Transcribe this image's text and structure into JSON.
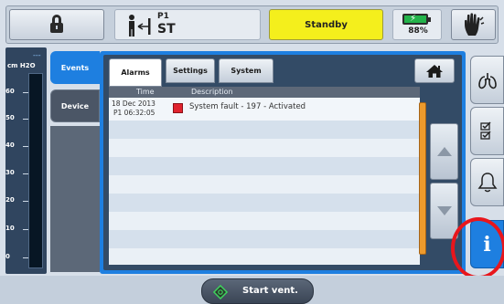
{
  "topbar": {
    "patient_id": "P1",
    "patient_mode": "ST",
    "status": "Standby",
    "battery_percent": "88%",
    "icons": [
      "lock-icon",
      "patient-icon",
      "battery-icon",
      "hand-icon"
    ]
  },
  "gauge": {
    "marker": "---",
    "unit": "cm H2O",
    "ticks": [
      "60",
      "50",
      "40",
      "30",
      "20",
      "10",
      "0"
    ]
  },
  "sidebar": {
    "items": [
      {
        "label": "Events",
        "selected": true
      },
      {
        "label": "Device",
        "selected": false
      }
    ]
  },
  "tabs": [
    {
      "label": "Alarms",
      "selected": true
    },
    {
      "label": "Settings",
      "selected": false
    },
    {
      "label": "System",
      "selected": false
    }
  ],
  "alarm_list": {
    "columns": [
      "Time",
      "Description"
    ],
    "rows": [
      {
        "date": "18 Dec 2013",
        "time": "P1 06:32:05",
        "description": "System fault - 197 - Activated",
        "severity_color": "#e0232e"
      }
    ]
  },
  "right_rail": {
    "icons": [
      "lungs-icon",
      "checklist-icon",
      "bell-icon",
      "info-icon"
    ],
    "info_label": "i",
    "highlight_color": "#e8161c"
  },
  "bottom": {
    "start_label": "Start vent."
  },
  "colors": {
    "accent": "#1e7fe0",
    "status": "#f4ef1c",
    "scroll": "#ed9a2c"
  }
}
